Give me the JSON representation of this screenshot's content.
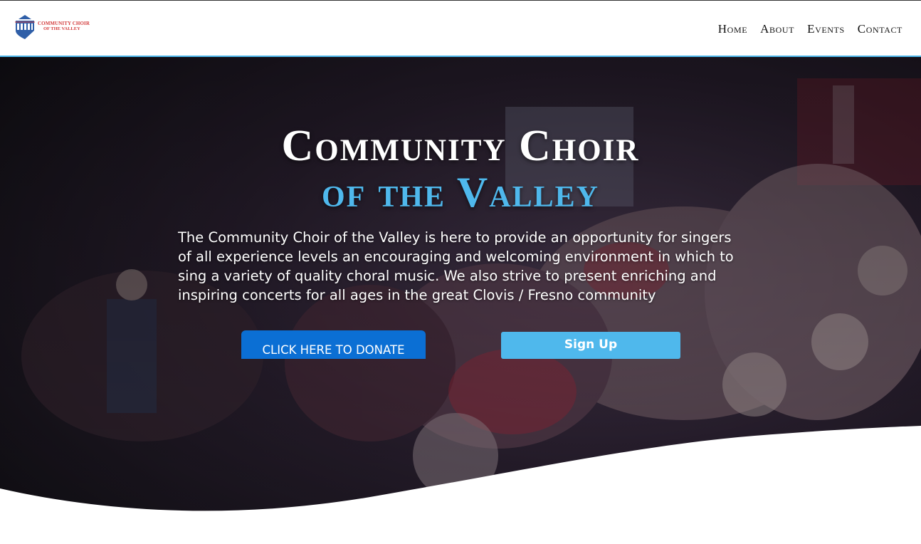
{
  "logo": {
    "line1": "COMMUNITY CHOIR",
    "line2": "OF THE VALLEY"
  },
  "nav": {
    "items": [
      {
        "label": "Home"
      },
      {
        "label": "About"
      },
      {
        "label": "Events"
      },
      {
        "label": "Contact"
      }
    ]
  },
  "hero": {
    "title_line1": "Community Choir",
    "title_line2": "of the Valley",
    "description": "The Community Choir of the Valley is here to provide an opportunity for singers of all experience levels an encouraging and welcoming environment in which to sing a variety of quality choral music. We also strive to present enriching and inspiring concerts for all ages in the great Clovis / Fresno community",
    "donate_label": "Click here to donate",
    "signup_label": "Sign Up"
  },
  "colors": {
    "accent": "#4fb8ec",
    "donate_button": "#0b6fd4",
    "logo_red": "#d33b3b",
    "logo_blue": "#2f5fa8"
  }
}
